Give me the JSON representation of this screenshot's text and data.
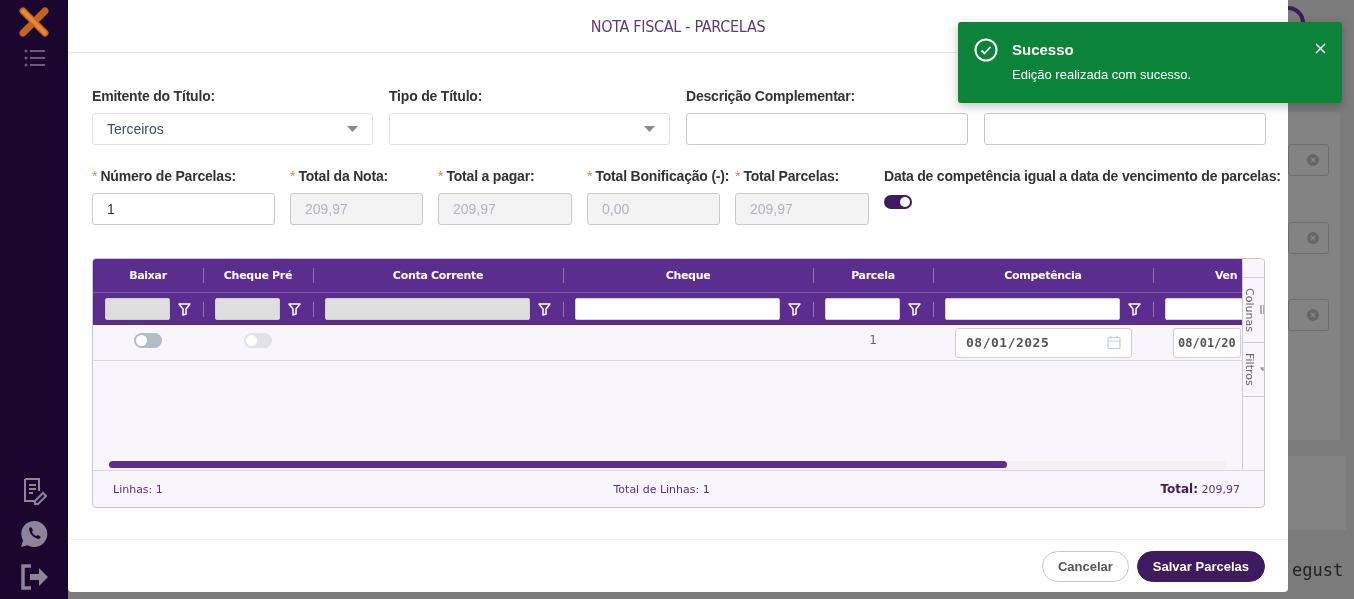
{
  "modal": {
    "title": "NOTA FISCAL - PARCELAS",
    "fields_row_1": [
      {
        "label": "Emitente do Título:",
        "kind": "select",
        "value": "Terceiros"
      },
      {
        "label": "Tipo de Título:",
        "kind": "select"
      },
      {
        "label": "Descrição Complementar:",
        "kind": "text"
      },
      {
        "kind": "text"
      }
    ],
    "fields_row_2": [
      {
        "required_mark": "*",
        "label": "Número de Parcelas:",
        "kind": "text",
        "value": "1",
        "disabled": false
      },
      {
        "required_mark": "*",
        "label": "Total da Nota:",
        "kind": "text",
        "value": "209,97",
        "disabled": true
      },
      {
        "required_mark": "*",
        "label": "Total a pagar:",
        "kind": "text",
        "value": "209,97",
        "disabled": true
      },
      {
        "required_mark": "*",
        "label": "Total Bonificação (-):",
        "kind": "text",
        "value": "0,00",
        "disabled": true
      },
      {
        "required_mark": "*",
        "label": "Total Parcelas:",
        "kind": "text",
        "value": "209,97",
        "disabled": true
      },
      {
        "label": "Data de competência igual a data de vencimento de parcelas:",
        "kind": "toggle",
        "on": true
      }
    ],
    "table": {
      "columns": [
        {
          "label": "Baixar",
          "filter_disabled": true
        },
        {
          "label": "Cheque Pré",
          "filter_disabled": true
        },
        {
          "label": "Conta Corrente",
          "filter_disabled": true
        },
        {
          "label": "Cheque",
          "filter_disabled": false
        },
        {
          "label": "Parcela",
          "filter_disabled": false
        },
        {
          "label": "Competência",
          "filter_disabled": false
        },
        {
          "label": "Ven",
          "filter_disabled": false
        }
      ],
      "rows": [
        {
          "cells": [
            {
              "kind": "toggle",
              "on": false,
              "disabled": false
            },
            {
              "kind": "toggle",
              "on": false,
              "disabled": true
            },
            {
              "kind": "blank"
            },
            {
              "kind": "blank"
            },
            {
              "kind": "text",
              "text": "1"
            },
            {
              "kind": "date",
              "value": "08/01/2025"
            },
            {
              "kind": "date",
              "value": "08/01/20"
            }
          ]
        }
      ],
      "side_tabs": [
        {
          "label": "Colunas",
          "kind": "columns"
        },
        {
          "label": "Filtros",
          "kind": "filters"
        }
      ],
      "footer": {
        "rows_label": "Linhas: 1",
        "total_rows": "Total de Linhas: 1",
        "total_label": "Total:",
        "total_value": "209,97"
      }
    },
    "buttons": [
      {
        "label": "Cancelar",
        "kind": "secondary"
      },
      {
        "label": "Salvar Parcelas",
        "kind": "primary"
      }
    ]
  },
  "toast": {
    "title": "Sucesso",
    "message": "Edição realizada com sucesso."
  },
  "background": {
    "text": "egust"
  }
}
